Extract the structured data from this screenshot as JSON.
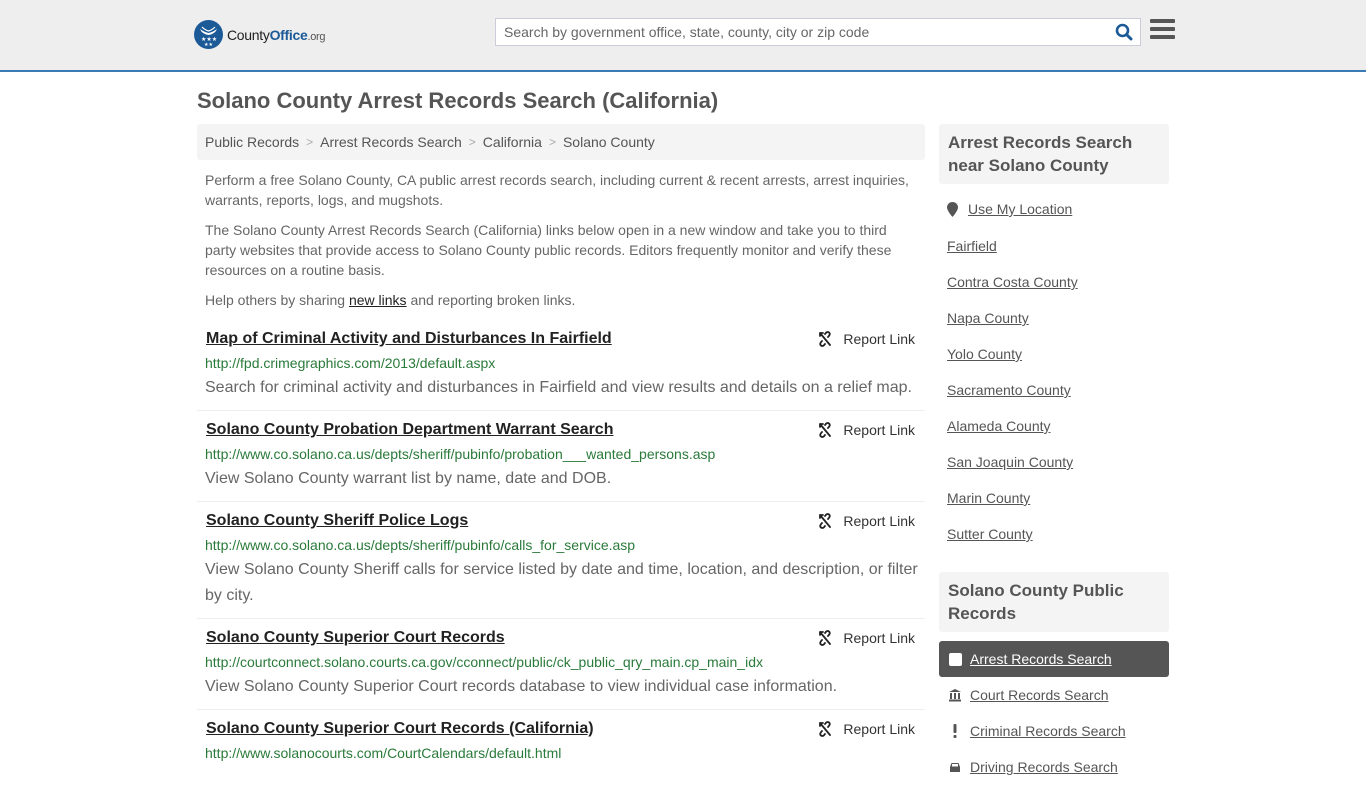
{
  "header": {
    "logo": {
      "name": "County",
      "bold": "Office",
      "suffix": ".org"
    },
    "search": {
      "placeholder": "Search by government office, state, county, city or zip code",
      "value": ""
    },
    "brand_color": "#1b5a96",
    "accent_border": "#3a7bb5"
  },
  "page": {
    "title": "Solano County Arrest Records Search (California)"
  },
  "breadcrumb": [
    {
      "label": "Public Records"
    },
    {
      "label": "Arrest Records Search"
    },
    {
      "label": "California"
    },
    {
      "label": "Solano County"
    }
  ],
  "intro": {
    "p1": "Perform a free Solano County, CA public arrest records search, including current & recent arrests, arrest inquiries, warrants, reports, logs, and mugshots.",
    "p2": "The Solano County Arrest Records Search (California) links below open in a new window and take you to third party websites that provide access to Solano County public records. Editors frequently monitor and verify these resources on a routine basis.",
    "p3_before": "Help others by sharing ",
    "p3_link": "new links",
    "p3_after": " and reporting broken links."
  },
  "report_label": "Report Link",
  "results": [
    {
      "title": "Map of Criminal Activity and Disturbances In Fairfield",
      "url": "http://fpd.crimegraphics.com/2013/default.aspx",
      "desc": "Search for criminal activity and disturbances in Fairfield and view results and details on a relief map."
    },
    {
      "title": "Solano County Probation Department Warrant Search",
      "url": "http://www.co.solano.ca.us/depts/sheriff/pubinfo/probation___wanted_persons.asp",
      "desc": "View Solano County warrant list by name, date and DOB."
    },
    {
      "title": "Solano County Sheriff Police Logs",
      "url": "http://www.co.solano.ca.us/depts/sheriff/pubinfo/calls_for_service.asp",
      "desc": "View Solano County Sheriff calls for service listed by date and time, location, and description, or filter by city."
    },
    {
      "title": "Solano County Superior Court Records",
      "url": "http://courtconnect.solano.courts.ca.gov/cconnect/public/ck_public_qry_main.cp_main_idx",
      "desc": "View Solano County Superior Court records database to view individual case information."
    },
    {
      "title": "Solano County Superior Court Records (California)",
      "url": "http://www.solanocourts.com/CourtCalendars/default.html",
      "desc": ""
    }
  ],
  "sidebar": {
    "nearby_title": "Arrest Records Search near Solano County",
    "use_location": "Use My Location",
    "nearby": [
      "Fairfield",
      "Contra Costa County",
      "Napa County",
      "Yolo County",
      "Sacramento County",
      "Alameda County",
      "San Joaquin County",
      "Marin County",
      "Sutter County"
    ],
    "records_title": "Solano County Public Records",
    "records": [
      {
        "label": "Arrest Records Search",
        "icon": "square-icon",
        "active": true
      },
      {
        "label": "Court Records Search",
        "icon": "courthouse-icon",
        "active": false
      },
      {
        "label": "Criminal Records Search",
        "icon": "exclamation-icon",
        "active": false
      },
      {
        "label": "Driving Records Search",
        "icon": "car-icon",
        "active": false
      }
    ]
  }
}
